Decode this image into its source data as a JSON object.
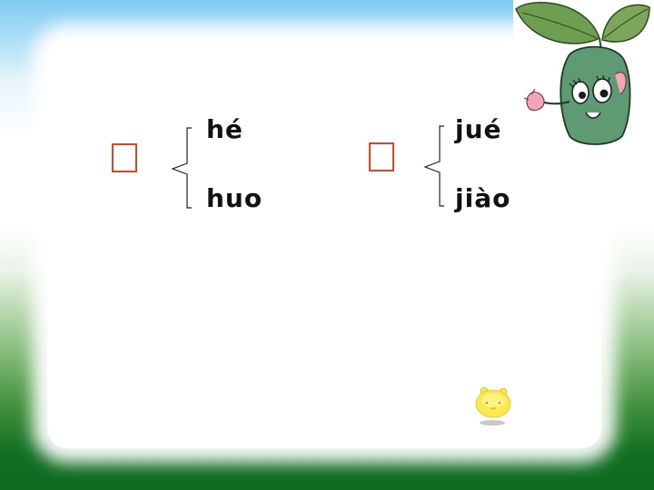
{
  "groups": [
    {
      "char_box": "",
      "readings": [
        "hé",
        "huo"
      ]
    },
    {
      "char_box": "",
      "readings": [
        "jué",
        "jiào"
      ]
    }
  ],
  "colors": {
    "box_border": "#d9461f",
    "sky": "#7fcbf2",
    "grass": "#126f23"
  },
  "icons": {
    "mascot": "sprout-mascot-icon",
    "bubble": "yellow-blob-icon"
  }
}
